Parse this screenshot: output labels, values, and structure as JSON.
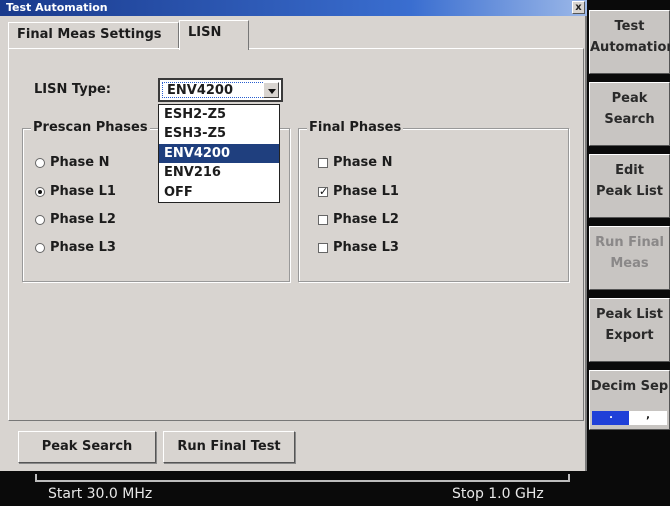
{
  "window": {
    "title": "Test Automation",
    "close_label": "x"
  },
  "tabs": [
    {
      "label": "Final Meas Settings",
      "active": false
    },
    {
      "label": "LISN",
      "active": true
    }
  ],
  "lisn": {
    "label": "LISN Type:",
    "value": "ENV4200",
    "options": [
      "ESH2-Z5",
      "ESH3-Z5",
      "ENV4200",
      "ENV216",
      "OFF"
    ],
    "selected": "ENV4200"
  },
  "prescan": {
    "title": "Prescan Phases",
    "options": [
      {
        "label": "Phase N",
        "selected": false
      },
      {
        "label": "Phase L1",
        "selected": true
      },
      {
        "label": "Phase L2",
        "selected": false
      },
      {
        "label": "Phase L3",
        "selected": false
      }
    ]
  },
  "final": {
    "title": "Final Phases",
    "options": [
      {
        "label": "Phase N",
        "checked": false
      },
      {
        "label": "Phase L1",
        "checked": true
      },
      {
        "label": "Phase L2",
        "checked": false
      },
      {
        "label": "Phase L3",
        "checked": false
      }
    ]
  },
  "buttons": {
    "peak_search": "Peak Search",
    "run_final_test": "Run Final Test"
  },
  "softkeys": [
    {
      "line1": "Test",
      "line2": "Automation",
      "enabled": true
    },
    {
      "line1": "Peak",
      "line2": "Search",
      "enabled": true
    },
    {
      "line1": "Edit",
      "line2": "Peak List",
      "enabled": true
    },
    {
      "line1": "Run Final",
      "line2": "Meas",
      "enabled": false
    },
    {
      "line1": "Peak List",
      "line2": "Export",
      "enabled": true
    },
    {
      "line1": "Decim Sep",
      "line2": "",
      "enabled": true
    }
  ],
  "decim": {
    "left": ".",
    "right": ","
  },
  "status": {
    "start": "Start 30.0 MHz",
    "stop": "Stop 1.0 GHz"
  },
  "colors": {
    "title_bar": "#1a3a8c",
    "selection": "#1f3f7e",
    "decim_active": "#1f40d8",
    "background": "#d8d4d0"
  }
}
